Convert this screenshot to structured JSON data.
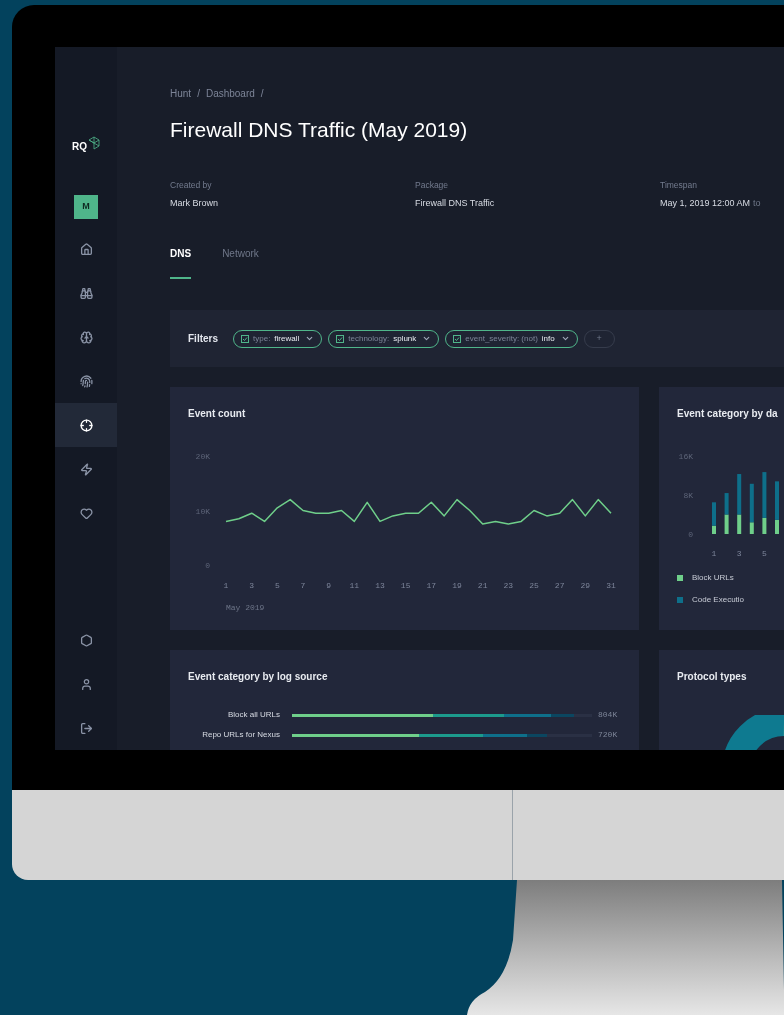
{
  "sidebar": {
    "logo": "RQ",
    "avatar": "M",
    "items": [
      {
        "selected": false
      },
      {
        "selected": false
      },
      {
        "selected": false
      },
      {
        "selected": false
      },
      {
        "selected": true
      },
      {
        "selected": false
      },
      {
        "selected": false
      }
    ],
    "bottom_items": [
      {
        "selected": false
      },
      {
        "selected": false
      },
      {
        "selected": false
      }
    ]
  },
  "breadcrumb": [
    "Hunt",
    "Dashboard"
  ],
  "breadcrumb_separator": "/",
  "title": "Firewall DNS Traffic (May 2019)",
  "meta": [
    {
      "label": "Created by",
      "value": "Mark Brown"
    },
    {
      "label": "Package",
      "value": "Firewall DNS Traffic"
    },
    {
      "label": "Timespan",
      "value": "May 1, 2019 12:00 AM",
      "suffix": "to"
    }
  ],
  "tabs": [
    {
      "label": "DNS",
      "selected": true
    },
    {
      "label": "Network",
      "selected": false
    }
  ],
  "filters": {
    "label": "Filters",
    "add": "+",
    "chips": [
      {
        "key": "type:",
        "value": "firewall",
        "checked": true
      },
      {
        "key": "technology:",
        "value": "splunk",
        "checked": true
      },
      {
        "key": "event_severity: (not)",
        "value": "info",
        "checked": true
      }
    ]
  },
  "event_count": {
    "chart_data": {
      "type": "line",
      "title": "Event count",
      "xlabel": "May 2019",
      "xlim": [
        1,
        31
      ],
      "x": [
        1,
        2,
        3,
        4,
        5,
        6,
        7,
        8,
        9,
        10,
        11,
        12,
        13,
        14,
        15,
        16,
        17,
        18,
        19,
        20,
        21,
        22,
        23,
        24,
        25,
        26,
        27,
        28,
        29,
        30,
        31
      ],
      "xticks": [
        1,
        3,
        5,
        7,
        9,
        11,
        13,
        15,
        17,
        19,
        21,
        23,
        25,
        27,
        29,
        31
      ],
      "yticks": [
        0,
        {
          "value": 10000,
          "label": "10K"
        },
        {
          "value": 20000,
          "label": "20K"
        }
      ],
      "ylim": [
        0,
        20000
      ],
      "series": [
        {
          "color": "#6fcf8a",
          "values": [
            8000,
            8500,
            9500,
            8000,
            10500,
            12000,
            10000,
            9500,
            9500,
            10000,
            8000,
            11500,
            8000,
            9000,
            9500,
            9500,
            11500,
            9000,
            12000,
            10000,
            7500,
            8000,
            7500,
            8000,
            10000,
            9000,
            9500,
            12000,
            9000,
            12000,
            9500
          ]
        }
      ]
    }
  },
  "category_by_day": {
    "chart_data": {
      "type": "bar",
      "stacked": true,
      "title": "Event category by da",
      "xlim": [
        0.5,
        6.5
      ],
      "x": [
        1,
        2,
        3,
        4,
        5,
        6
      ],
      "xticks": [
        1,
        3,
        5
      ],
      "yticks": [
        0,
        {
          "value": 8000,
          "label": "8K"
        },
        {
          "value": 16000,
          "label": "16K"
        }
      ],
      "ylim": [
        0,
        16000
      ],
      "series": [
        {
          "name": "Block URLs",
          "color": "#6fcf8a",
          "values": [
            1700,
            4000,
            4000,
            2400,
            3300,
            2900
          ]
        },
        {
          "name": "Code Executio",
          "color": "#0e6f8a",
          "values": [
            4800,
            4400,
            8300,
            7900,
            9400,
            7900
          ]
        }
      ]
    }
  },
  "log_source": {
    "title": "Event category by log source",
    "rows": [
      {
        "label": "Block all URLs",
        "reading": "804K",
        "level": 0.94
      },
      {
        "label": "Repo URLs for Nexus",
        "reading": "720K",
        "level": 0.85
      }
    ]
  },
  "protocol_types": {
    "title": "Protocol types"
  }
}
